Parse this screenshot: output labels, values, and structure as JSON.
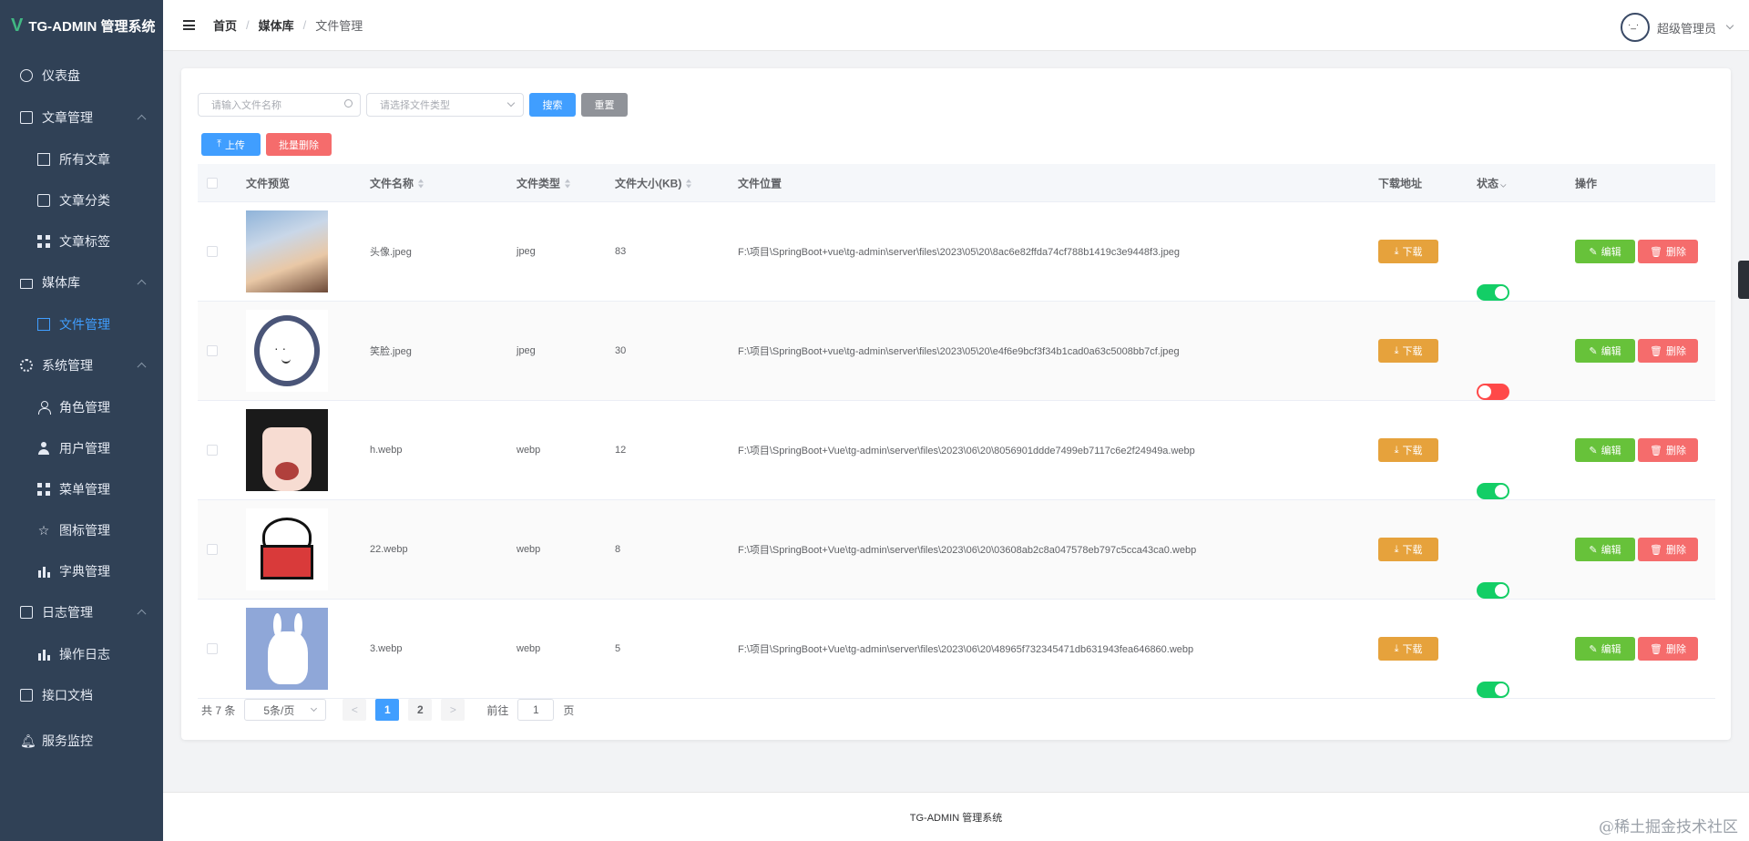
{
  "app": {
    "logo_letter": "V",
    "title": "TG-ADMIN 管理系统"
  },
  "sidebar": {
    "items": [
      {
        "label": "仪表盘",
        "icon": "dashboard-icon"
      },
      {
        "label": "文章管理",
        "icon": "document-icon"
      },
      {
        "label": "所有文章",
        "icon": "book-icon"
      },
      {
        "label": "文章分类",
        "icon": "category-icon"
      },
      {
        "label": "文章标签",
        "icon": "tag-grid-icon"
      },
      {
        "label": "媒体库",
        "icon": "folder-icon"
      },
      {
        "label": "文件管理",
        "icon": "image-icon"
      },
      {
        "label": "系统管理",
        "icon": "gear-icon"
      },
      {
        "label": "角色管理",
        "icon": "role-icon"
      },
      {
        "label": "用户管理",
        "icon": "user-icon"
      },
      {
        "label": "菜单管理",
        "icon": "menu-grid-icon"
      },
      {
        "label": "图标管理",
        "icon": "star-icon"
      },
      {
        "label": "字典管理",
        "icon": "bar-chart-icon"
      },
      {
        "label": "日志管理",
        "icon": "log-icon"
      },
      {
        "label": "操作日志",
        "icon": "bar-chart-icon"
      },
      {
        "label": "接口文档",
        "icon": "api-doc-icon"
      },
      {
        "label": "服务监控",
        "icon": "bell-icon"
      }
    ]
  },
  "header": {
    "breadcrumb": [
      "首页",
      "媒体库",
      "文件管理"
    ],
    "breadcrumb_sep": "/",
    "user_name": "超级管理员"
  },
  "search": {
    "name_placeholder": "请输入文件名称",
    "type_placeholder": "请选择文件类型",
    "search_label": "搜索",
    "reset_label": "重置",
    "upload_label": "上传",
    "batch_delete_label": "批量删除"
  },
  "table": {
    "columns": {
      "preview": "文件预览",
      "name": "文件名称",
      "type": "文件类型",
      "size": "文件大小(KB)",
      "location": "文件位置",
      "download": "下载地址",
      "status": "状态",
      "actions": "操作"
    },
    "download_label": "下载",
    "edit_label": "编辑",
    "delete_label": "删除",
    "rows": [
      {
        "name": "头像.jpeg",
        "type": "jpeg",
        "size": "83",
        "path": "F:\\项目\\SpringBoot+vue\\tg-admin\\server\\files\\2023\\05\\20\\8ac6e82ffda74cf788b1419c3e9448f3.jpeg",
        "enabled": true
      },
      {
        "name": "笑脸.jpeg",
        "type": "jpeg",
        "size": "30",
        "path": "F:\\项目\\SpringBoot+vue\\tg-admin\\server\\files\\2023\\05\\20\\e4f6e9bcf3f34b1cad0a63c5008bb7cf.jpeg",
        "enabled": false
      },
      {
        "name": "h.webp",
        "type": "webp",
        "size": "12",
        "path": "F:\\项目\\SpringBoot+Vue\\tg-admin\\server\\files\\2023\\06\\20\\8056901ddde7499eb7117c6e2f24949a.webp",
        "enabled": true
      },
      {
        "name": "22.webp",
        "type": "webp",
        "size": "8",
        "path": "F:\\项目\\SpringBoot+Vue\\tg-admin\\server\\files\\2023\\06\\20\\03608ab2c8a047578eb797c5cca43ca0.webp",
        "enabled": true
      },
      {
        "name": "3.webp",
        "type": "webp",
        "size": "5",
        "path": "F:\\项目\\SpringBoot+Vue\\tg-admin\\server\\files\\2023\\06\\20\\48965f732345471db631943fea646860.webp",
        "enabled": true
      }
    ]
  },
  "pagination": {
    "total_text": "共 7 条",
    "page_size": "5条/页",
    "pages": [
      "1",
      "2"
    ],
    "current_page": "1",
    "prev_symbol": "<",
    "next_symbol": ">",
    "goto_prefix": "前往",
    "goto_value": "1",
    "goto_suffix": "页"
  },
  "footer": {
    "text": "TG-ADMIN 管理系统",
    "watermark": "@稀土掘金技术社区"
  },
  "colors": {
    "sidebar_bg": "#304156",
    "primary": "#409eff",
    "warning": "#e6a23c",
    "success": "#67c23a",
    "danger": "#f56c6c"
  }
}
